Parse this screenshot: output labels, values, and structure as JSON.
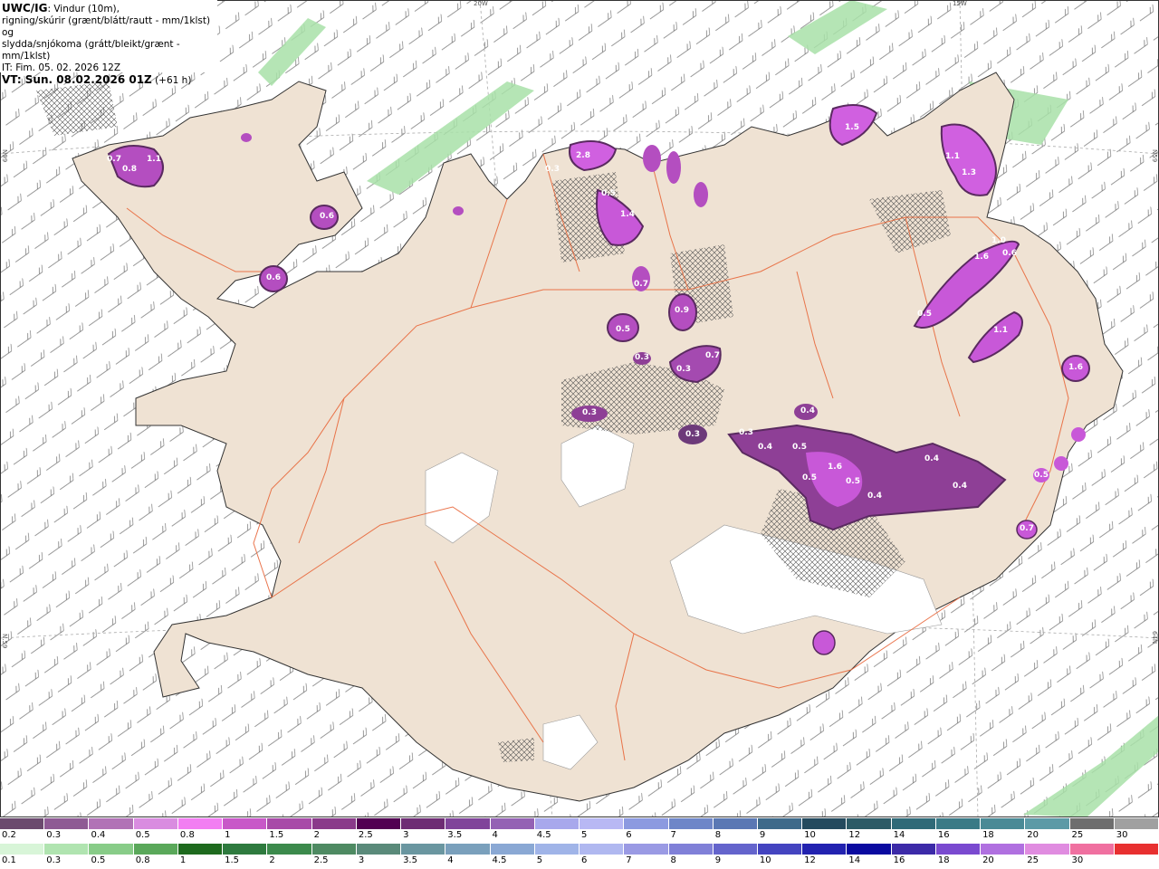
{
  "header": {
    "model": "UWC/IG",
    "line1_rest": ": Vindur (10m),",
    "line2": "rigning/skúrir (grænt/blátt/rautt - mm/1klst) og",
    "line3": "slydda/snjókoma (grátt/bleikt/grænt - mm/1klst)",
    "line4": "IT: Fim. 05. 02. 2026 12Z",
    "line5_bold": "VT: Sun. 08.02.2026 01Z",
    "line5_rest": " (+61 h)"
  },
  "axes": {
    "top_lons": [
      "20W",
      "15W"
    ],
    "left_lats": [
      "N99",
      "N.59"
    ],
    "right_lats": [
      "N59",
      "64N"
    ]
  },
  "colors": {
    "land": "#efe2d3",
    "sea": "#ffffff",
    "glacier": "#ffffff",
    "roads": "#e8673a",
    "coast": "#333333",
    "snow_purple": "#c05ad0",
    "snow_dark": "#6d3a7a",
    "rain_green": "#b9e8b9"
  },
  "precip_labels": [
    {
      "v": "0.7"
    },
    {
      "v": "0.8"
    },
    {
      "v": "1.1"
    },
    {
      "v": "0.6"
    },
    {
      "v": "0.6"
    },
    {
      "v": "2.8"
    },
    {
      "v": "0.3"
    },
    {
      "v": "0.5"
    },
    {
      "v": "1.4"
    },
    {
      "v": "0.7"
    },
    {
      "v": "0.5"
    },
    {
      "v": "0.9"
    },
    {
      "v": "0.7"
    },
    {
      "v": "0.3"
    },
    {
      "v": "0.3"
    },
    {
      "v": "0.3"
    },
    {
      "v": "0.3"
    },
    {
      "v": "0.4"
    },
    {
      "v": "0.5"
    },
    {
      "v": "0.3"
    },
    {
      "v": "0.4"
    },
    {
      "v": "0.5"
    },
    {
      "v": "1.6"
    },
    {
      "v": "0.5"
    },
    {
      "v": "0.4"
    },
    {
      "v": "0.4"
    },
    {
      "v": "1.5"
    },
    {
      "v": "1.3"
    },
    {
      "v": "1.6"
    },
    {
      "v": "0.5"
    },
    {
      "v": "1.1"
    },
    {
      "v": "1.6"
    },
    {
      "v": "0.6"
    },
    {
      "v": "0.7"
    },
    {
      "v": "0.5"
    },
    {
      "v": "0.4"
    },
    {
      "v": "1.1"
    },
    {
      "v": "1.0"
    }
  ],
  "legend": {
    "snow_colors": [
      "#6b4a6e",
      "#8e5a94",
      "#b172b6",
      "#d98ce0",
      "#f27ef2",
      "#c858c8",
      "#a84aa8",
      "#8a3a8a",
      "#520052",
      "#6e2c74",
      "#80449a",
      "#9462b4",
      "#a8a8ec",
      "#b8b8f4",
      "#8c9ae0",
      "#6e86c8",
      "#5a78b4",
      "#3e6a8a",
      "#244a5e",
      "#2c5a66",
      "#306a78",
      "#3a7a86",
      "#4a8a96",
      "#5c9aa6",
      "#6e6e6e",
      "#a0a0a0"
    ],
    "snow_labels": [
      "0.2",
      "0.3",
      "0.4",
      "0.5",
      "0.8",
      "1",
      "1.5",
      "2",
      "2.5",
      "3",
      "3.5",
      "4",
      "4.5",
      "5",
      "6",
      "7",
      "8",
      "9",
      "10",
      "12",
      "14",
      "16",
      "18",
      "20",
      "25",
      "30"
    ],
    "rain_colors": [
      "#d8f5d8",
      "#b0e4b0",
      "#88cc88",
      "#5aa85a",
      "#1e6a1e",
      "#2e7a3e",
      "#3c8a4c",
      "#4e8a62",
      "#5a8a7a",
      "#6a96a0",
      "#7aa0bc",
      "#8aa8d4",
      "#a0b4e8",
      "#b0b8f0",
      "#9a9ae4",
      "#8080d8",
      "#6464cc",
      "#4444c0",
      "#2222b0",
      "#0a0aa0",
      "#3c2aa8",
      "#7a4ad0",
      "#b070e0",
      "#e08ce0",
      "#f070a0",
      "#e83030"
    ],
    "rain_labels": [
      "0.1",
      "0.3",
      "0.5",
      "0.8",
      "1",
      "1.5",
      "2",
      "2.5",
      "3",
      "3.5",
      "4",
      "4.5",
      "5",
      "6",
      "7",
      "8",
      "9",
      "10",
      "12",
      "14",
      "16",
      "18",
      "20",
      "25",
      "30"
    ]
  }
}
